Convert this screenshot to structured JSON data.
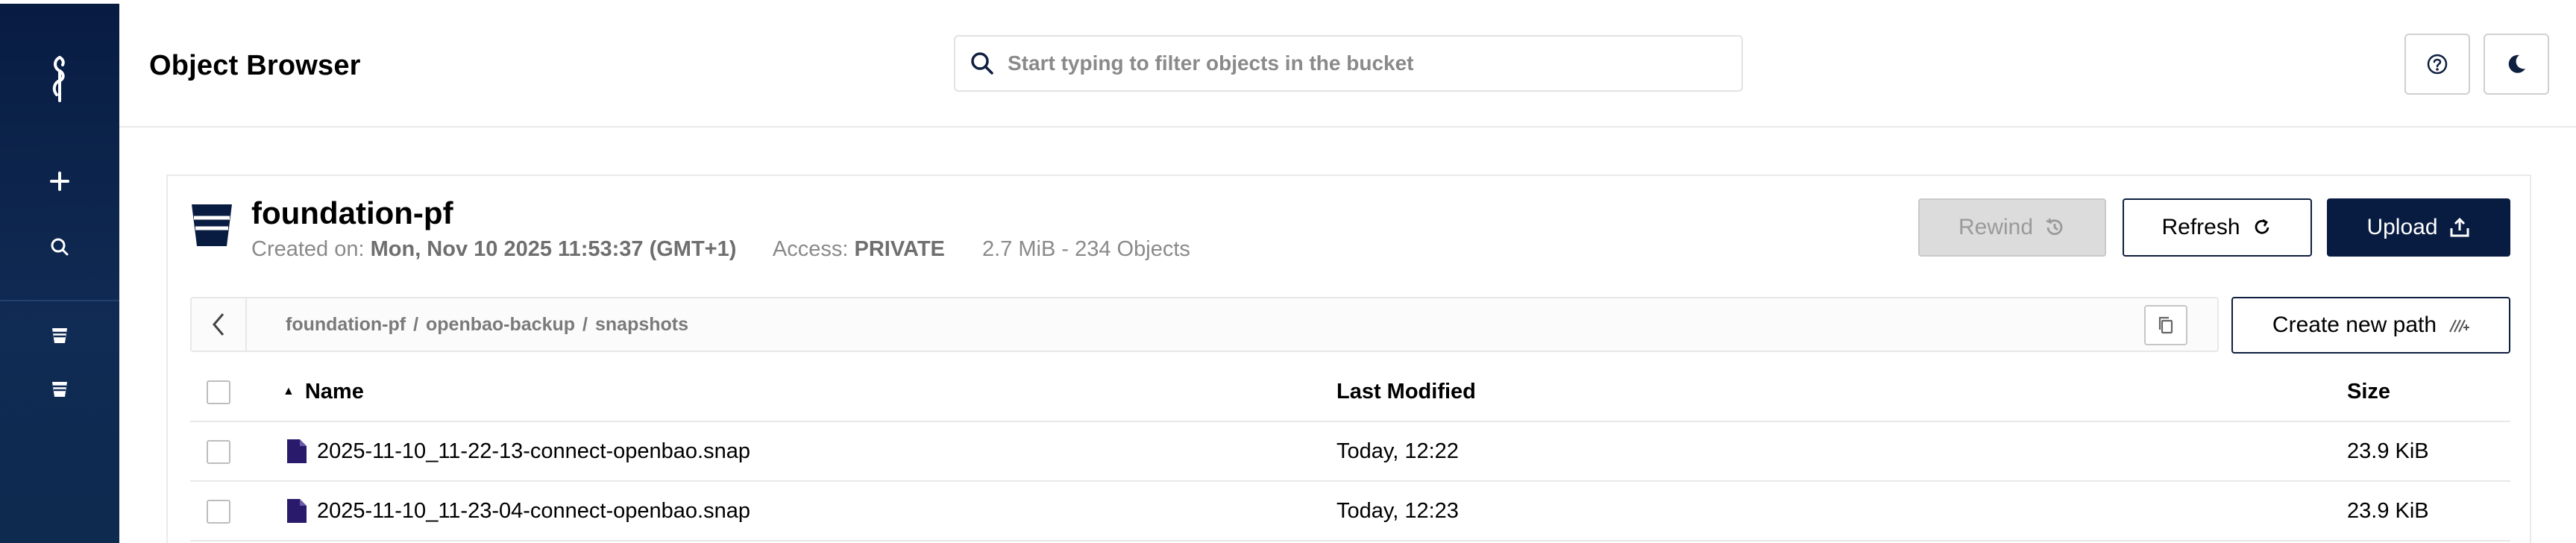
{
  "header": {
    "title": "Object Browser",
    "search_placeholder": "Start typing to filter objects in the bucket",
    "help_icon": "help-circle-icon",
    "theme_icon": "moon-icon"
  },
  "sidebar": {
    "logo_icon": "minio-logo-icon",
    "items": [
      {
        "icon": "plus-icon"
      },
      {
        "icon": "search-icon"
      },
      {
        "icon": "bucket-icon"
      },
      {
        "icon": "bucket-icon"
      }
    ]
  },
  "bucket": {
    "name": "foundation-pf",
    "created_label": "Created on:",
    "created_value": "Mon, Nov 10 2025 11:53:37 (GMT+1)",
    "access_label": "Access:",
    "access_value": "PRIVATE",
    "usage": "2.7 MiB - 234 Objects"
  },
  "actions": {
    "rewind": "Rewind",
    "refresh": "Refresh",
    "upload": "Upload",
    "create_path": "Create new path"
  },
  "breadcrumb": {
    "parts": [
      "foundation-pf",
      "openbao-backup",
      "snapshots"
    ],
    "separator": "/"
  },
  "table": {
    "columns": {
      "name": "Name",
      "modified": "Last Modified",
      "size": "Size"
    },
    "sort_indicator": "▲",
    "rows": [
      {
        "name": "2025-11-10_11-22-13-connect-openbao.snap",
        "modified": "Today, 12:22",
        "size": "23.9 KiB"
      },
      {
        "name": "2025-11-10_11-23-04-connect-openbao.snap",
        "modified": "Today, 12:23",
        "size": "23.9 KiB"
      }
    ]
  },
  "colors": {
    "sidebar": "#081C42",
    "primary": "#081C42",
    "file_icon": "#2a1a6b",
    "disabled": "#dcdcdc"
  }
}
